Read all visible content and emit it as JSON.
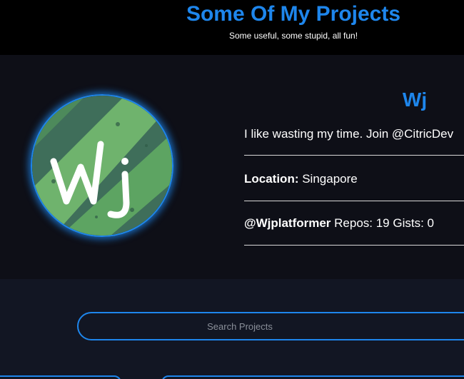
{
  "header": {
    "title": "Some Of My Projects",
    "subtitle": "Some useful, some stupid, all fun!"
  },
  "profile": {
    "avatar_icon": "wj-logo-avatar",
    "avatar_text": "Wj",
    "name": "Wj",
    "bio": "I like wasting my time. Join @CitricDev",
    "location_label": "Location:",
    "location_value": " Singapore",
    "username": "@Wjplatformer",
    "stats": " Repos: 19 Gists: 0"
  },
  "search": {
    "placeholder": "Search Projects",
    "value": ""
  },
  "colors": {
    "accent": "#1e86ec",
    "header_bg": "#000000",
    "profile_bg": "#0e0f17",
    "page_bg": "#121623"
  }
}
